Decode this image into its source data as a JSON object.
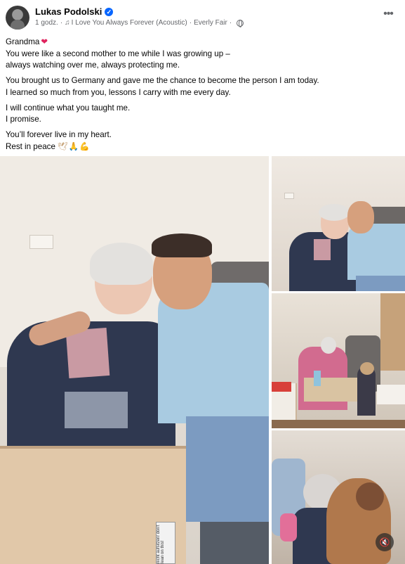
{
  "post": {
    "author": "Lukas Podolski",
    "time": "1 godz.",
    "dot": "·",
    "music_icon": "♫",
    "song": "I Love You Always Forever (Acoustic)",
    "artist": "Everly Fair",
    "more_label": "•••",
    "audience_icon": "globe-icon"
  },
  "text": {
    "p1": [
      "Grandma",
      "You were like a second mother to me while I was growing up –",
      "always watching over me, always protecting me."
    ],
    "p2": [
      "You brought us to Germany and gave me the chance to become the person I am today.",
      "I learned so much from you, lessons I carry with me every day."
    ],
    "p3": [
      "I will continue what you taught me.",
      "I promise."
    ],
    "p4": [
      "You’ll forever live in my heart.",
      "Rest in peace"
    ],
    "heart": "❤",
    "emojis": "🕊🙏💪"
  },
  "media": {
    "mute_icon": "🔇",
    "sticker_text": "nicht aufsitzen! don't lean on this!"
  },
  "colors": {
    "accent": "#0866ff",
    "secondary_text": "#65676b",
    "heart": "#e0245e"
  }
}
